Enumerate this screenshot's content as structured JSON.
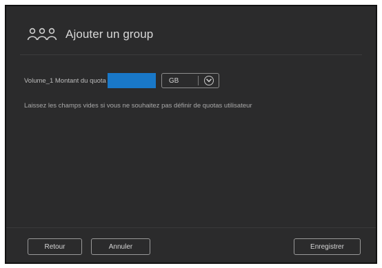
{
  "dialog": {
    "title": "Ajouter un group",
    "title_icon": "group-icon"
  },
  "quota": {
    "label": "Volume_1 Montant du quota",
    "value": "",
    "unit": "GB",
    "unit_chevron_icon": "chevron-down-icon"
  },
  "hint": "Laissez les champs vides si vous ne souhaitez pas définir de quotas utilisateur",
  "footer": {
    "back_label": "Retour",
    "cancel_label": "Annuler",
    "save_label": "Enregistrer"
  },
  "colors": {
    "dialog_bg": "#2b2b2c",
    "input_accent": "#1978c8"
  }
}
